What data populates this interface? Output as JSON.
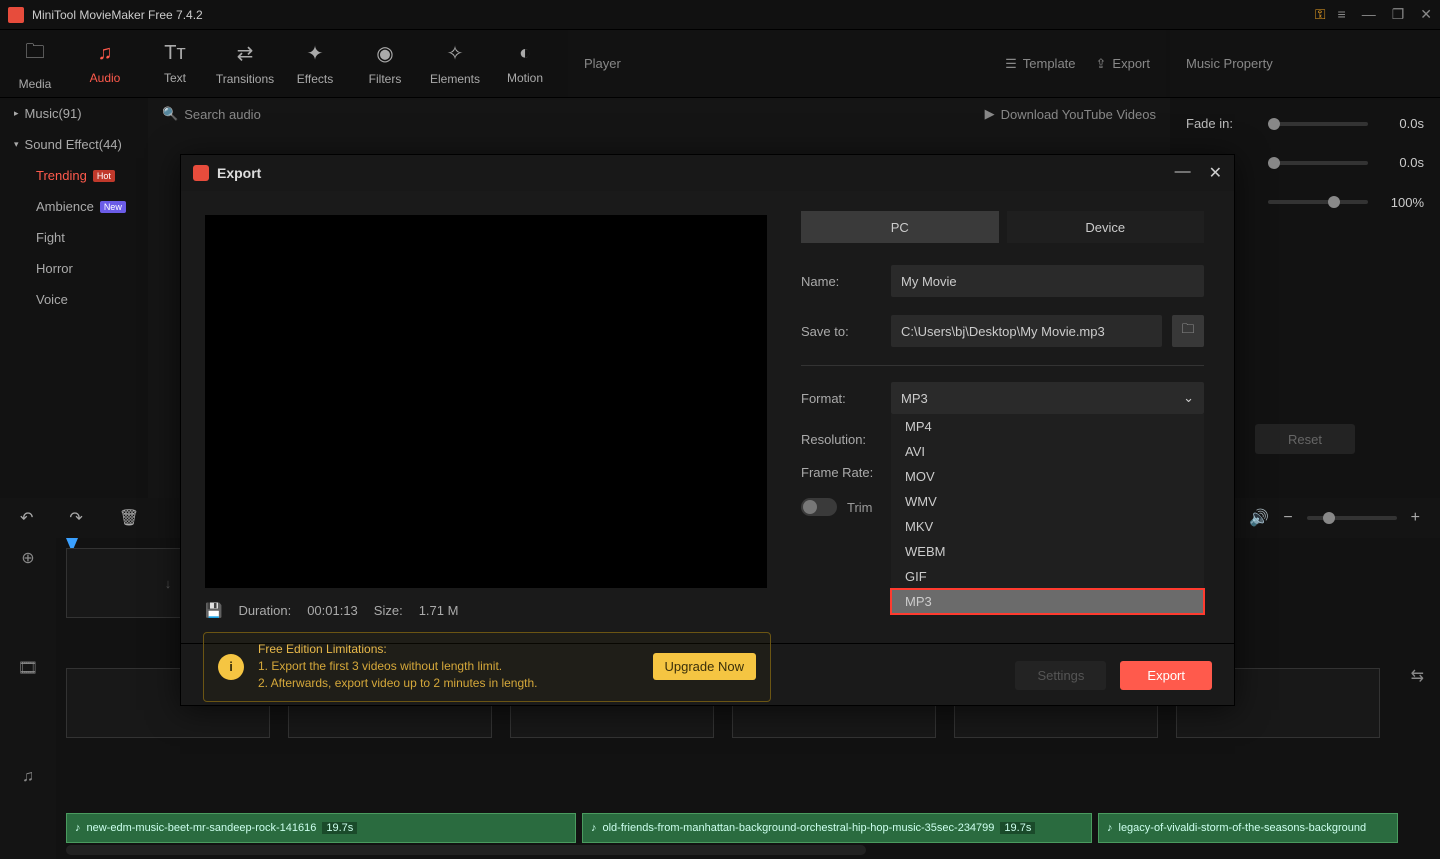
{
  "app": {
    "title": "MiniTool MovieMaker Free 7.4.2"
  },
  "toolbar": {
    "tabs": {
      "media": "Media",
      "audio": "Audio",
      "text": "Text",
      "transitions": "Transitions",
      "effects": "Effects",
      "filters": "Filters",
      "elements": "Elements",
      "motion": "Motion"
    },
    "player": "Player",
    "template": "Template",
    "export": "Export"
  },
  "sidebar": {
    "music": "Music(91)",
    "sound_effect": "Sound Effect(44)",
    "items": {
      "trending": "Trending",
      "ambience": "Ambience",
      "fight": "Fight",
      "horror": "Horror",
      "voice": "Voice"
    },
    "badges": {
      "hot": "Hot",
      "new": "New"
    }
  },
  "center": {
    "search_placeholder": "Search audio",
    "download": "Download YouTube Videos"
  },
  "props": {
    "title": "Music Property",
    "fade_in_label": "Fade in:",
    "fade_in_val": "0.0s",
    "fade_out_val": "0.0s",
    "volume_val": "100%",
    "reset": "Reset"
  },
  "export_modal": {
    "title": "Export",
    "tabs": {
      "pc": "PC",
      "device": "Device"
    },
    "name_label": "Name:",
    "name_value": "My Movie",
    "save_label": "Save to:",
    "save_value": "C:\\Users\\bj\\Desktop\\My Movie.mp3",
    "format_label": "Format:",
    "format_value": "MP3",
    "format_options": [
      "MP4",
      "AVI",
      "MOV",
      "WMV",
      "MKV",
      "WEBM",
      "GIF",
      "MP3"
    ],
    "format_selected": "MP3",
    "resolution_label": "Resolution:",
    "framerate_label": "Frame Rate:",
    "trim_label": "Trim",
    "duration_label": "Duration:",
    "duration_value": "00:01:13",
    "size_label": "Size:",
    "size_value": "1.71 M",
    "limitations_title": "Free Edition Limitations:",
    "limitations_line1": "1. Export the first 3 videos without length limit.",
    "limitations_line2": "2. Afterwards, export video up to 2 minutes in length.",
    "upgrade": "Upgrade Now",
    "settings": "Settings",
    "export_btn": "Export"
  },
  "timeline": {
    "clips": [
      {
        "name": "new-edm-music-beet-mr-sandeep-rock-141616",
        "dur": "19.7s"
      },
      {
        "name": "old-friends-from-manhattan-background-orchestral-hip-hop-music-35sec-234799",
        "dur": "19.7s"
      },
      {
        "name": "legacy-of-vivaldi-storm-of-the-seasons-background",
        "dur": ""
      }
    ]
  }
}
